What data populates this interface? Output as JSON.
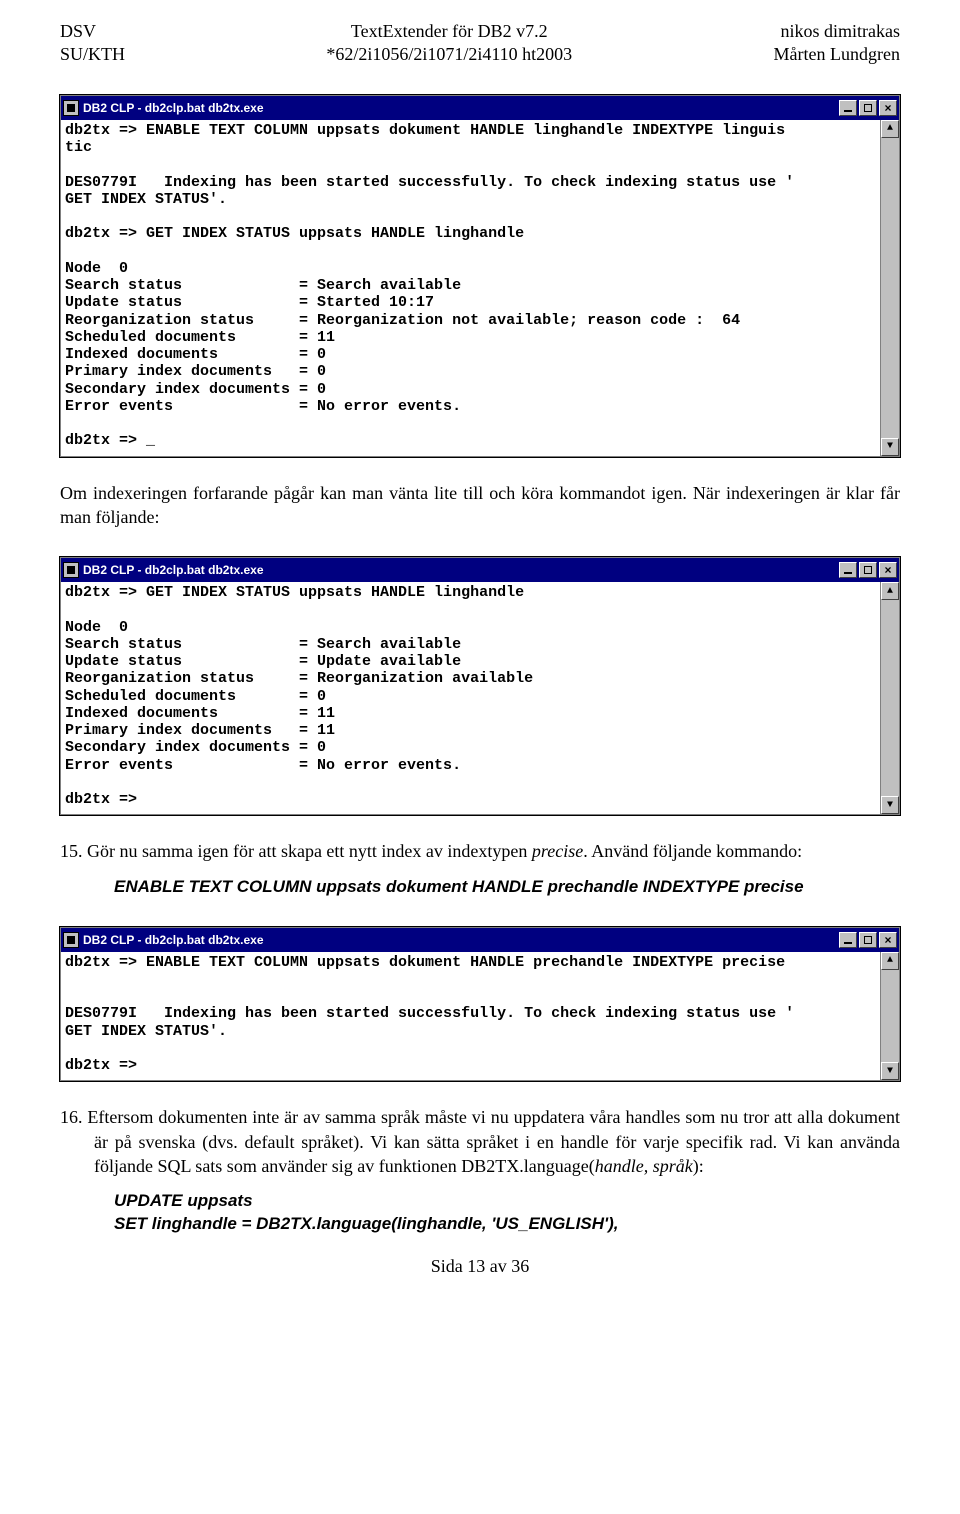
{
  "header": {
    "left1": "DSV",
    "left2": "SU/KTH",
    "center1": "TextExtender för DB2 v7.2",
    "center2": "*62/2i1056/2i1071/2i4110 ht2003",
    "right1": "nikos dimitrakas",
    "right2": "Mårten Lundgren"
  },
  "console1": {
    "title": "DB2 CLP - db2clp.bat db2tx.exe",
    "text": "db2tx => ENABLE TEXT COLUMN uppsats dokument HANDLE linghandle INDEXTYPE linguis\ntic\n\nDES0779I   Indexing has been started successfully. To check indexing status use '\nGET INDEX STATUS'.\n\ndb2tx => GET INDEX STATUS uppsats HANDLE linghandle\n\nNode  0\nSearch status             = Search available\nUpdate status             = Started 10:17\nReorganization status     = Reorganization not available; reason code :  64\nScheduled documents       = 11\nIndexed documents         = 0\nPrimary index documents   = 0\nSecondary index documents = 0\nError events              = No error events.\n\ndb2tx => _"
  },
  "para1": "Om indexeringen forfarande pågår kan man vänta lite till och köra kommandot igen. När indexeringen är klar får man följande:",
  "console2": {
    "title": "DB2 CLP - db2clp.bat db2tx.exe",
    "text": "db2tx => GET INDEX STATUS uppsats HANDLE linghandle\n\nNode  0\nSearch status             = Search available\nUpdate status             = Update available\nReorganization status     = Reorganization available\nScheduled documents       = 0\nIndexed documents         = 11\nPrimary index documents   = 11\nSecondary index documents = 0\nError events              = No error events.\n\ndb2tx =>"
  },
  "item15_a": "15. Gör nu samma igen för att skapa ett nytt index av indextypen ",
  "item15_precise": "precise",
  "item15_b": ". Använd följande kommando:",
  "cmd1": "ENABLE TEXT COLUMN uppsats dokument HANDLE prechandle INDEXTYPE precise",
  "console3": {
    "title": "DB2 CLP - db2clp.bat db2tx.exe",
    "text": "db2tx => ENABLE TEXT COLUMN uppsats dokument HANDLE prechandle INDEXTYPE precise\n\n\nDES0779I   Indexing has been started successfully. To check indexing status use '\nGET INDEX STATUS'.\n\ndb2tx =>"
  },
  "item16_a": "16. Eftersom dokumenten inte är av samma språk måste vi nu uppdatera våra handles som nu tror att alla dokument är på svenska (dvs. default språket). Vi kan sätta språket i en handle för varje specifik rad. Vi kan använda följande SQL sats som använder sig av funktionen DB2TX.language(",
  "item16_args": "handle, språk",
  "item16_b": "):",
  "cmd2a": "UPDATE uppsats",
  "cmd2b": "SET linghandle = DB2TX.language(linghandle, 'US_ENGLISH'),",
  "footer": "Sida 13 av 36",
  "glyphs": {
    "scroll_up": "▲",
    "scroll_down": "▼",
    "close_x": "×"
  }
}
